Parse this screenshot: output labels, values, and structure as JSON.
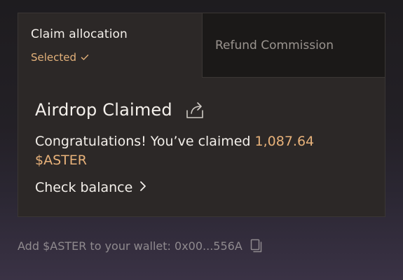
{
  "tabs": [
    {
      "title": "Claim allocation",
      "status": "Selected",
      "active": true
    },
    {
      "title": "Refund Commission",
      "active": false
    }
  ],
  "claim": {
    "heading": "Airdrop Claimed",
    "message_prefix": "Congratulations! You’ve claimed ",
    "amount": "1,087.64 $ASTER",
    "check_balance_label": "Check balance"
  },
  "footer": {
    "add_label": "Add $ASTER to your wallet: 0x00...556A"
  },
  "icons": {
    "status": "checkmark-icon",
    "share": "share-icon",
    "check_balance": "chevron-right-icon",
    "copy": "copy-icon"
  },
  "colors": {
    "accent": "#e8b27a",
    "panel": "#2c2827",
    "inactive_tab": "#1b1918"
  }
}
